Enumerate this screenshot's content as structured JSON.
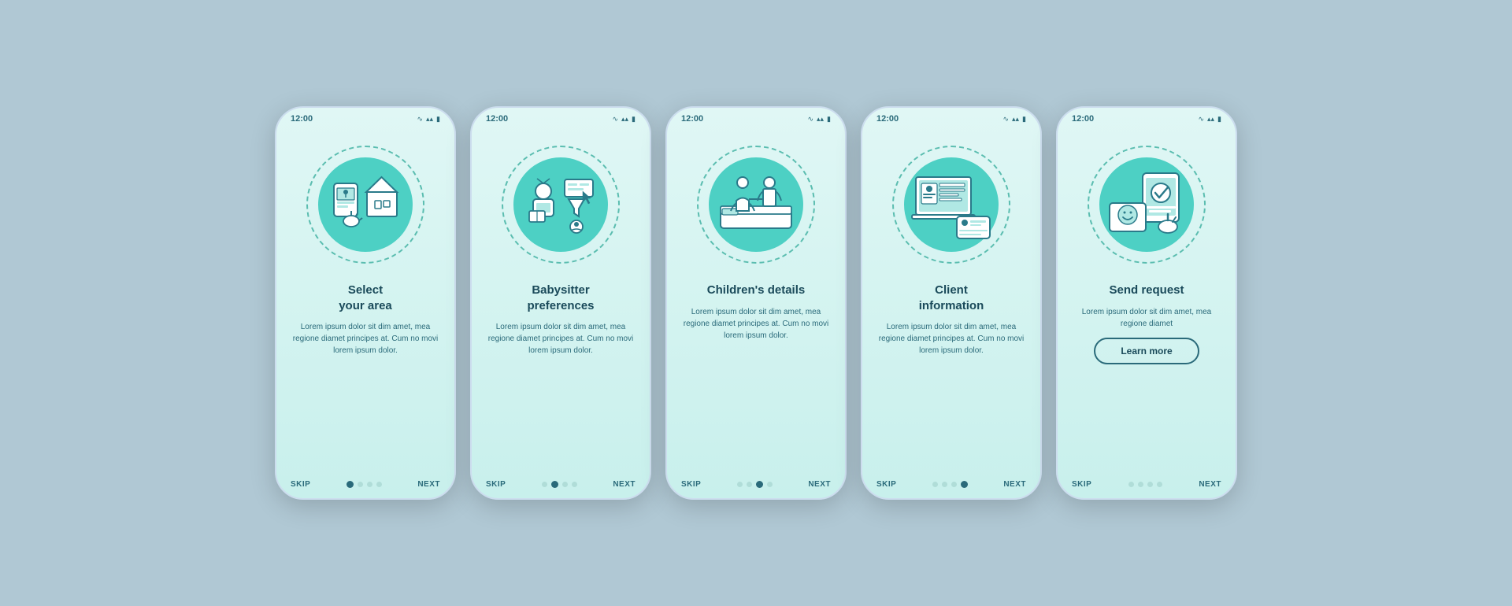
{
  "background": "#b0c8d4",
  "phones": [
    {
      "id": "phone-1",
      "time": "12:00",
      "title": "Select\nyour area",
      "body": "Lorem ipsum dolor sit dim amet, mea regione diamet principes at. Cum no movi lorem ipsum dolor.",
      "skip": "SKIP",
      "next": "NEXT",
      "dots": [
        true,
        false,
        false,
        false
      ],
      "active_dot": 0,
      "has_button": false,
      "button_label": ""
    },
    {
      "id": "phone-2",
      "time": "12:00",
      "title": "Babysitter\npreferences",
      "body": "Lorem ipsum dolor sit dim amet, mea regione diamet principes at. Cum no movi lorem ipsum dolor.",
      "skip": "SKIP",
      "next": "NEXT",
      "dots": [
        false,
        true,
        false,
        false
      ],
      "active_dot": 1,
      "has_button": false,
      "button_label": ""
    },
    {
      "id": "phone-3",
      "time": "12:00",
      "title": "Children's details",
      "body": "Lorem ipsum dolor sit dim amet, mea regione diamet principes at. Cum no movi lorem ipsum dolor.",
      "skip": "SKIP",
      "next": "NEXT",
      "dots": [
        false,
        false,
        true,
        false
      ],
      "active_dot": 2,
      "has_button": false,
      "button_label": ""
    },
    {
      "id": "phone-4",
      "time": "12:00",
      "title": "Client\ninformation",
      "body": "Lorem ipsum dolor sit dim amet, mea regione diamet principes at. Cum no movi lorem ipsum dolor.",
      "skip": "SKIP",
      "next": "NEXT",
      "dots": [
        false,
        false,
        false,
        true
      ],
      "active_dot": 3,
      "has_button": false,
      "button_label": ""
    },
    {
      "id": "phone-5",
      "time": "12:00",
      "title": "Send request",
      "body": "Lorem ipsum dolor sit dim amet, mea regione diamet",
      "skip": "SKIP",
      "next": "NEXT",
      "dots": [
        false,
        false,
        false,
        false
      ],
      "active_dot": 4,
      "has_button": true,
      "button_label": "Learn more"
    }
  ],
  "icons": {
    "wifi": "⊃",
    "signal": "▲",
    "battery": "▮"
  }
}
